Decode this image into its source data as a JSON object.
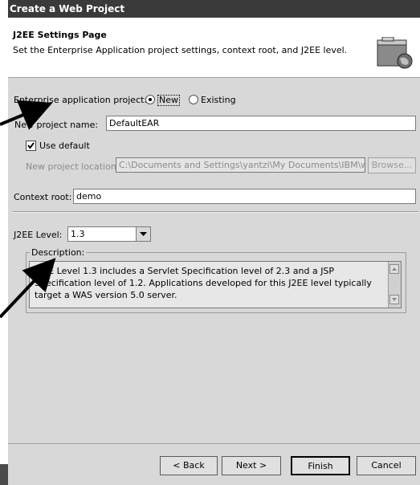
{
  "window": {
    "title": "Create a Web Project"
  },
  "header": {
    "title": "J2EE Settings Page",
    "description": "Set the Enterprise Application project settings, context root, and J2EE level.",
    "icon": "web-project-globe-icon"
  },
  "ear": {
    "label": "Enterprise application project:",
    "option_new": "New",
    "option_existing": "Existing",
    "selected": "New",
    "name_label": "New project name:",
    "name_value": "DefaultEAR",
    "use_default_label": "Use default",
    "use_default_checked": true,
    "location_label": "New project location:",
    "location_value": "C:\\Documents and Settings\\yantzi\\My Documents\\IBM\\wds",
    "browse_label": "Browse..."
  },
  "context": {
    "label": "Context root:",
    "value": "demo"
  },
  "j2ee": {
    "level_label": "J2EE Level:",
    "level_value": "1.3",
    "description_label": "Description:",
    "description_text": "J2EE Level 1.3 includes a Servlet Specification level of 2.3 and a JSP Specification level of 1.2.  Applications developed for this J2EE level typically target a WAS version 5.0 server."
  },
  "buttons": {
    "back": "< Back",
    "next": "Next >",
    "finish": "Finish",
    "cancel": "Cancel"
  }
}
